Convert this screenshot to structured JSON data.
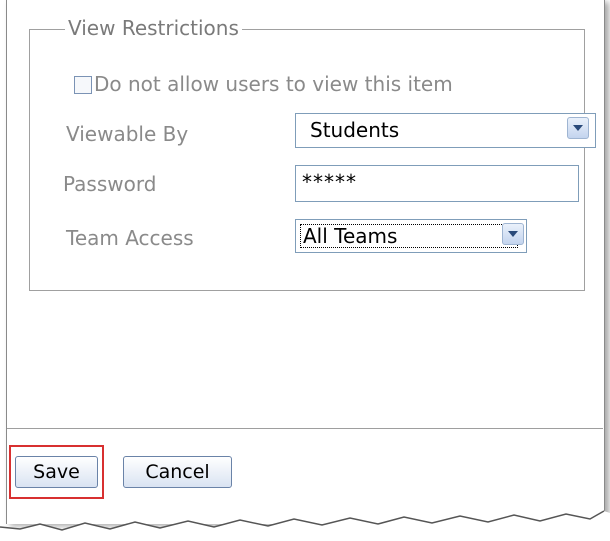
{
  "view_restrictions": {
    "legend": "View Restrictions",
    "checkbox_label": "Do not allow users to view this item",
    "checkbox_checked": false,
    "viewable_by": {
      "label": "Viewable By",
      "value": "Students"
    },
    "password": {
      "label": "Password",
      "value": "*****"
    },
    "team_access": {
      "label": "Team Access",
      "value": "All Teams"
    }
  },
  "actions": {
    "save_label": "Save",
    "cancel_label": "Cancel",
    "highlight_color": "#d83030"
  },
  "colors": {
    "label_gray": "#8a8a8a",
    "button_border": "#6a83a8"
  }
}
